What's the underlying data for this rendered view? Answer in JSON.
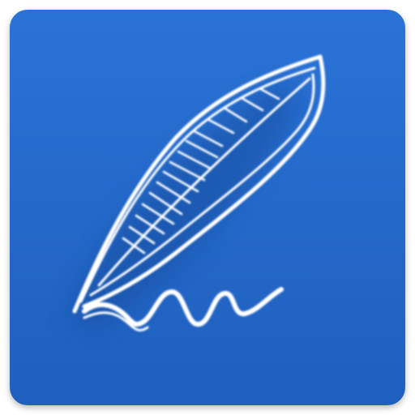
{
  "icon": {
    "name": "quill-signature-icon",
    "background_color": "#2468c9",
    "stroke_color": "#ffffff"
  }
}
